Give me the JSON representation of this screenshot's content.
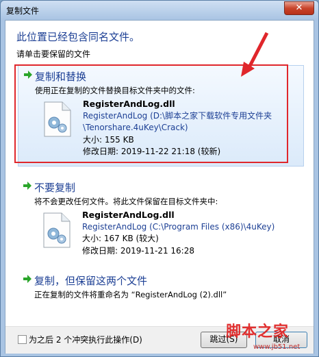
{
  "window": {
    "title": "复制文件",
    "close_glyph": "✕"
  },
  "heading": "此位置已经包含同名文件。",
  "subheading": "请单击要保留的文件",
  "options": [
    {
      "title": "复制和替换",
      "description": "使用正在复制的文件替换目标文件夹中的文件:",
      "file_name": "RegisterAndLog.dll",
      "path_line1": "RegisterAndLog (D:\\脚本之家下载软件专用文件夹",
      "path_line2": "\\Tenorshare.4uKey\\Crack)",
      "size": "大小: 155 KB",
      "modified": "修改日期: 2019-11-22 21:18 (较新)"
    },
    {
      "title": "不要复制",
      "description": "将不会更改任何文件。将此文件保留在目标文件夹中:",
      "file_name": "RegisterAndLog.dll",
      "path_line1": "RegisterAndLog (C:\\Program Files (x86)\\4uKey)",
      "size": "大小: 167 KB (较大)",
      "modified": "修改日期: 2019-11-21 16:28"
    },
    {
      "title": "复制，但保留这两个文件",
      "description": "正在复制的文件将重命名为 “RegisterAndLog (2).dll”"
    }
  ],
  "footer": {
    "checkbox_label": "为之后 2 个冲突执行此操作(D)",
    "checkbox_checked": false,
    "skip_label": "跳过(S)",
    "cancel_label": "取消"
  },
  "watermark": {
    "text": "脚本之家",
    "url": "www.jb51.net"
  },
  "colors": {
    "accent_blue": "#1c3f94",
    "annotation_red": "#e0262b",
    "arrow_green": "#2aa52a"
  }
}
